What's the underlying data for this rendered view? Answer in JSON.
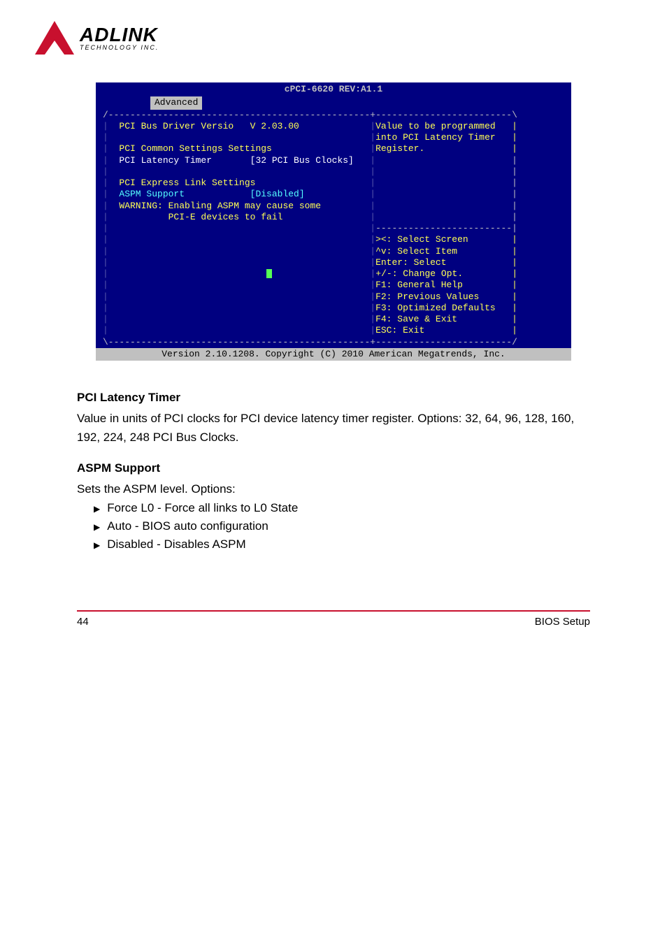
{
  "logo": {
    "main": "ADLINK",
    "sub": "TECHNOLOGY INC."
  },
  "bios": {
    "title": "cPCI-6620 REV:A1.1",
    "tab": "Advanced",
    "top_border": "/------------------------------------------------+-------------------------\\",
    "rows": [
      {
        "l": "|  ",
        "c1": "PCI Bus Driver Versio   V 2.03.00",
        "c1cls": "lbl-yellow",
        "mid": "             |",
        "r": "Value to be programmed   |",
        "rcls": "lbl-yellow"
      },
      {
        "l": "|  ",
        "c1": "",
        "mid": "                                              |",
        "r": "into PCI Latency Timer   |",
        "rcls": "lbl-yellow"
      },
      {
        "l": "|  ",
        "c1": "PCI Common Settings Settings",
        "c1cls": "lbl-yellow",
        "mid": "                  |",
        "r": "Register.                |",
        "rcls": "lbl-yellow"
      },
      {
        "l": "|  ",
        "c1": "PCI Latency Timer       [32 PCI Bus Clocks]",
        "c1cls": "lbl-white",
        "mid": "   |",
        "r": "                         |"
      },
      {
        "l": "|  ",
        "c1": "",
        "mid": "                                              |",
        "r": "                         |"
      },
      {
        "l": "|  ",
        "c1": "PCI Express Link Settings",
        "c1cls": "lbl-yellow",
        "mid": "                     |",
        "r": "                         |"
      },
      {
        "l": "|  ",
        "c1": "ASPM Support            [Disabled]",
        "c1cls": "lbl-cyan",
        "mid": "            |",
        "r": "                         |"
      },
      {
        "l": "|  ",
        "c1": "WARNING: Enabling ASPM may cause some",
        "c1cls": "lbl-yellow",
        "mid": "         |",
        "r": "                         |"
      },
      {
        "l": "|  ",
        "c1": "         PCI-E devices to fail",
        "c1cls": "lbl-yellow",
        "mid": "                |",
        "r": "                         |"
      },
      {
        "l": "|",
        "c1": "",
        "mid": "                                                |",
        "r": "-------------------------|",
        "rcls": ""
      },
      {
        "l": "|",
        "c1": "",
        "mid": "                                                |",
        "r": "><: Select Screen        |",
        "rcls": "lbl-yellow"
      },
      {
        "l": "|",
        "c1": "",
        "mid": "                                                |",
        "r": "^v: Select Item          |",
        "rcls": "lbl-yellow"
      },
      {
        "l": "|",
        "c1": "",
        "mid": "                                                |",
        "r": "Enter: Select            |",
        "rcls": "lbl-yellow"
      },
      {
        "l": "|",
        "c1": "                             ",
        "caret": true,
        "mid": "                  |",
        "r": "+/-: Change Opt.         |",
        "rcls": "lbl-yellow"
      },
      {
        "l": "|",
        "c1": "",
        "mid": "                                                |",
        "r": "F1: General Help         |",
        "rcls": "lbl-yellow"
      },
      {
        "l": "|",
        "c1": "",
        "mid": "                                                |",
        "r": "F2: Previous Values      |",
        "rcls": "lbl-yellow"
      },
      {
        "l": "|",
        "c1": "",
        "mid": "                                                |",
        "r": "F3: Optimized Defaults   |",
        "rcls": "lbl-yellow"
      },
      {
        "l": "|",
        "c1": "",
        "mid": "                                                |",
        "r": "F4: Save & Exit          |",
        "rcls": "lbl-yellow"
      },
      {
        "l": "|",
        "c1": "",
        "mid": "                                                |",
        "r": "ESC: Exit                |",
        "rcls": "lbl-yellow"
      }
    ],
    "bottom_border": "\\------------------------------------------------+-------------------------/",
    "footer": "Version 2.10.1208. Copyright (C) 2010 American Megatrends, Inc."
  },
  "doc": {
    "h1": "PCI Latency Timer",
    "p1": "Value in units of PCI clocks for PCI device latency timer register. Options: 32, 64, 96, 128, 160, 192, 224, 248 PCI Bus Clocks.",
    "h2": "ASPM Support",
    "p2": "Sets the ASPM level. Options:",
    "opts": [
      "Force L0 - Force all links to L0 State",
      "Auto - BIOS auto configuration",
      "Disabled - Disables ASPM"
    ]
  },
  "foot": {
    "left": "44",
    "right": "BIOS Setup"
  }
}
